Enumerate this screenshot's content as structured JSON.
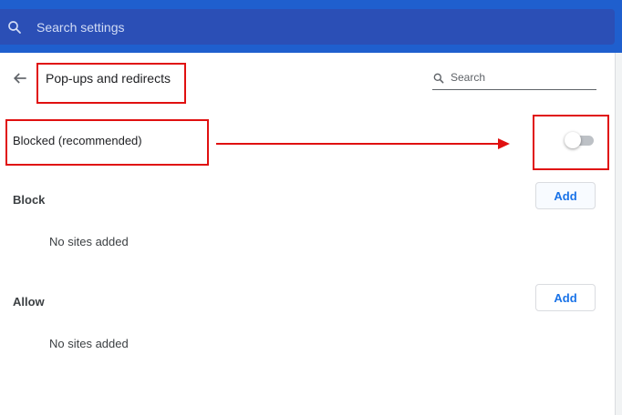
{
  "header": {
    "search_placeholder": "Search settings",
    "search_icon": "search-icon"
  },
  "page": {
    "title": "Pop-ups and redirects",
    "back_icon": "arrow-back-icon",
    "search_placeholder": "Search"
  },
  "blocked_toggle": {
    "label": "Blocked (recommended)",
    "state": "off"
  },
  "block_section": {
    "label": "Block",
    "add_label": "Add",
    "empty_text": "No sites added"
  },
  "allow_section": {
    "label": "Allow",
    "add_label": "Add",
    "empty_text": "No sites added"
  },
  "colors": {
    "header_bg": "#1f5fce",
    "search_bg": "#2b4fb6",
    "annotation_red": "#e01010",
    "button_text": "#1a73e8"
  }
}
